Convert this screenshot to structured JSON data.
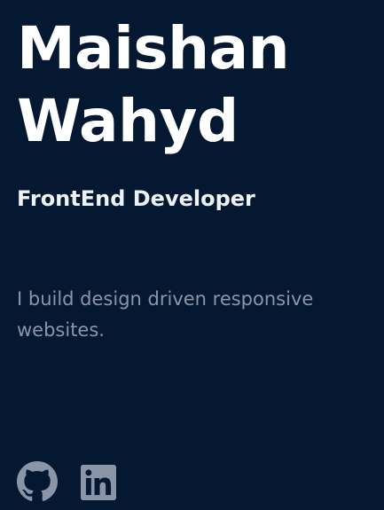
{
  "hero": {
    "name_line1": "Maishan",
    "name_line2": "Wahyd",
    "role": "FrontEnd Developer",
    "tagline": "I build design driven responsive websites."
  },
  "socials": [
    {
      "icon": "github-icon",
      "color": "#8a95a8"
    },
    {
      "icon": "linkedin-icon",
      "color": "#8a95a8"
    }
  ],
  "colors": {
    "background": "#051832",
    "heading": "#ffffff",
    "muted": "#8a95a8"
  }
}
